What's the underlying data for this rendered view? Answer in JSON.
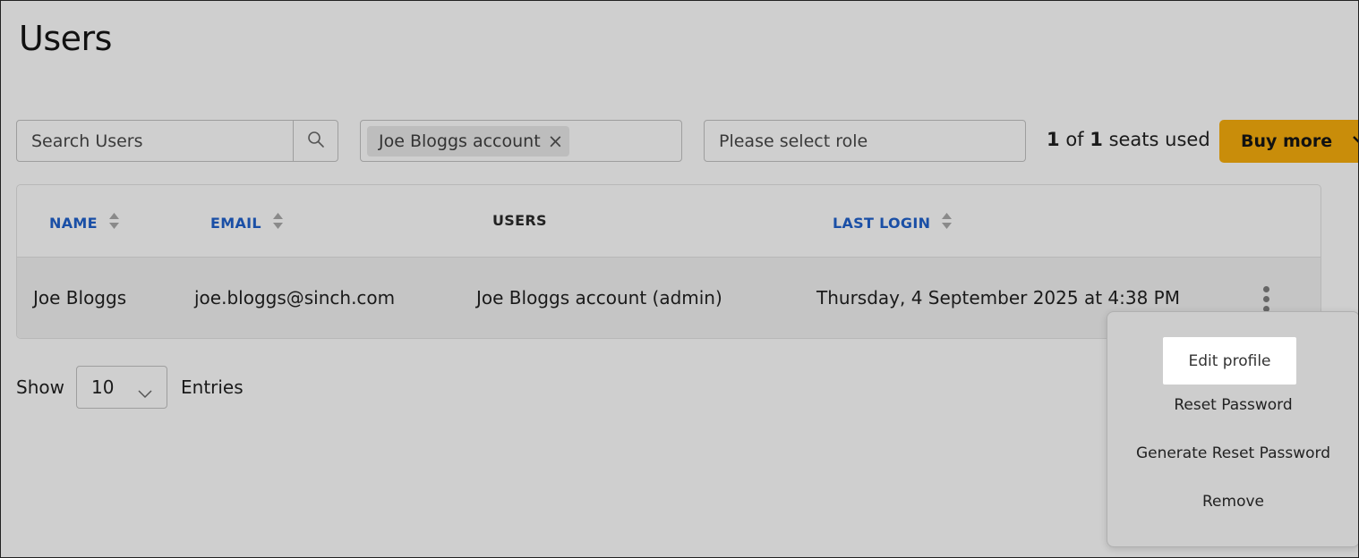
{
  "page": {
    "title": "Users"
  },
  "toolbar": {
    "search_placeholder": "Search Users",
    "account_chip": "Joe Bloggs account",
    "role_placeholder": "Please select role",
    "seats": {
      "used": "1",
      "of_text": "of",
      "total": "1",
      "suffix": "seats used"
    },
    "buy_label": "Buy more"
  },
  "table": {
    "columns": [
      {
        "label": "NAME",
        "sortable": true
      },
      {
        "label": "EMAIL",
        "sortable": true
      },
      {
        "label": "USERS",
        "sortable": false
      },
      {
        "label": "LAST LOGIN",
        "sortable": true
      }
    ],
    "rows": [
      {
        "name": "Joe Bloggs",
        "email": "joe.bloggs@sinch.com",
        "users": "Joe Bloggs account (admin)",
        "last_login": "Thursday, 4 September 2025 at 4:38 PM"
      }
    ]
  },
  "pagination": {
    "show_label": "Show",
    "page_size": "10",
    "entries_label": "Entries"
  },
  "row_menu": {
    "items": [
      {
        "label": "Edit profile",
        "highlighted": true
      },
      {
        "label": "Reset Password"
      },
      {
        "label": "Generate Reset Password"
      },
      {
        "label": "Remove"
      }
    ]
  },
  "colors": {
    "accent": "#c98d0a",
    "link": "#1a4fa6",
    "background": "#cfcfcf"
  }
}
